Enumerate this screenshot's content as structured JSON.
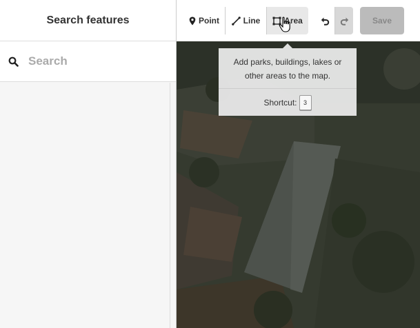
{
  "sidebar": {
    "title": "Search features",
    "search": {
      "placeholder": "Search",
      "value": ""
    }
  },
  "toolbar": {
    "modes": [
      {
        "label": "Point",
        "icon": "map-pin-icon"
      },
      {
        "label": "Line",
        "icon": "line-icon"
      },
      {
        "label": "Area",
        "icon": "area-icon"
      }
    ],
    "undo_icon": "undo-icon",
    "redo_icon": "redo-icon",
    "save_label": "Save"
  },
  "tooltip": {
    "text": "Add parks, buildings, lakes or other areas to the map.",
    "shortcut_label": "Shortcut:",
    "shortcut_key": "3"
  },
  "colors": {
    "toolbar_bg": "#ffffff",
    "active_mode_bg": "#e8e8e8",
    "save_disabled_bg": "#bbbbbb",
    "tooltip_bg": "#ebebeb"
  }
}
